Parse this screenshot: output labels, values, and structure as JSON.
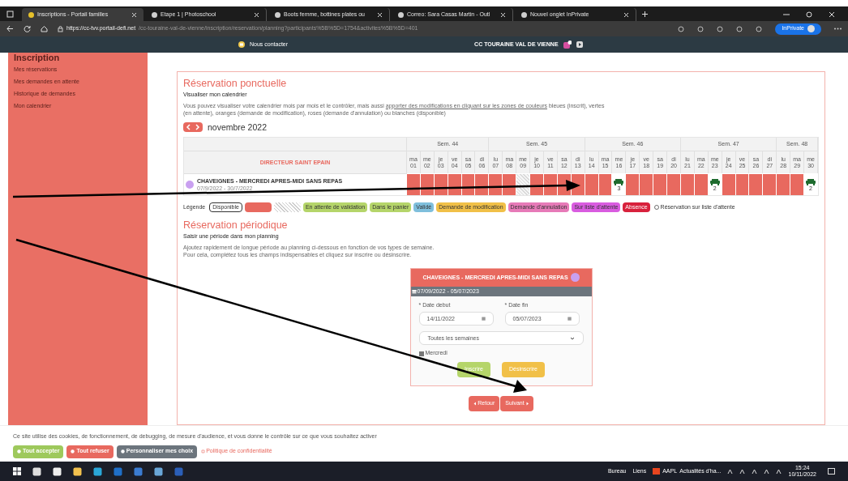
{
  "browser": {
    "tabs": [
      {
        "title": "Inscriptions - Portail familles",
        "selected": true
      },
      {
        "title": "Etape 1 | Photoschool",
        "selected": false
      },
      {
        "title": "Boots femme, bottines plates ou",
        "selected": false
      },
      {
        "title": "Correo: Sara Casas Martin - Outl",
        "selected": false
      },
      {
        "title": "Nouvel onglet InPrivate",
        "selected": false
      }
    ],
    "url_host": "https://cc-tvv.portail-defi.net",
    "url_path": "/cc-touraine-val-de-vienne/inscription/reservation/planning?participants%5B%5D=1754&activites%5B%5D=401",
    "profile": "InPrivate"
  },
  "header": {
    "contact": "Nous contacter",
    "organisation": "CC TOURAINE VAL DE VIENNE"
  },
  "sidebar": {
    "heading": "Inscription",
    "items": [
      "Mes réservations",
      "Mes demandes en attente",
      "Historique de demandes",
      "Mon calendrier"
    ]
  },
  "ponctuelle": {
    "title": "Réservation ponctuelle",
    "subtitle": "Visualiser mon calendrier",
    "description": "Vous pouvez visualiser votre calendrier mois par mois et le contrôler, mais aussi",
    "description_link": "apporter des modifications en cliquant sur les zones de couleurs",
    "description_end": "bleues (inscrit), vertes (en attente), oranges (demande de modification), roses (demande d'annulation) ou blanches (disponible)",
    "month": "novembre 2022",
    "group": "DIRECTEUR SAINT EPAIN",
    "weeks": [
      {
        "label": "Sem. 44",
        "days": [
          [
            "ma",
            "01"
          ],
          [
            "me",
            "02"
          ],
          [
            "je",
            "03"
          ],
          [
            "ve",
            "04"
          ],
          [
            "sa",
            "05"
          ],
          [
            "di",
            "06"
          ]
        ]
      },
      {
        "label": "Sem. 45",
        "days": [
          [
            "lu",
            "07"
          ],
          [
            "ma",
            "08"
          ],
          [
            "me",
            "09"
          ],
          [
            "je",
            "10"
          ],
          [
            "ve",
            "11"
          ],
          [
            "sa",
            "12"
          ],
          [
            "di",
            "13"
          ]
        ]
      },
      {
        "label": "Sem. 46",
        "days": [
          [
            "lu",
            "14"
          ],
          [
            "ma",
            "15"
          ],
          [
            "me",
            "16"
          ],
          [
            "je",
            "17"
          ],
          [
            "ve",
            "18"
          ],
          [
            "sa",
            "19"
          ],
          [
            "di",
            "20"
          ]
        ]
      },
      {
        "label": "Sem. 47",
        "days": [
          [
            "lu",
            "21"
          ],
          [
            "ma",
            "22"
          ],
          [
            "me",
            "23"
          ],
          [
            "je",
            "24"
          ],
          [
            "ve",
            "25"
          ],
          [
            "sa",
            "26"
          ],
          [
            "di",
            "27"
          ]
        ]
      },
      {
        "label": "Sem. 48",
        "days": [
          [
            "lu",
            "28"
          ],
          [
            "ma",
            "29"
          ],
          [
            "me",
            "30"
          ]
        ]
      }
    ],
    "activity": {
      "name": "CHAVEIGNES - MERCREDI APRES-MIDI SANS REPAS",
      "dates": "07/9/2022 - 30/7/2022",
      "color": "#c9a0f0",
      "cells": [
        {
          "kind": "reserved"
        },
        {
          "kind": "reserved"
        },
        {
          "kind": "reserved"
        },
        {
          "kind": "reserved"
        },
        {
          "kind": "reserved"
        },
        {
          "kind": "reserved"
        },
        {
          "kind": "reserved"
        },
        {
          "kind": "reserved"
        },
        {
          "kind": "closed"
        },
        {
          "kind": "reserved"
        },
        {
          "kind": "reserved"
        },
        {
          "kind": "reserved"
        },
        {
          "kind": "reserved"
        },
        {
          "kind": "reserved"
        },
        {
          "kind": "reserved"
        },
        {
          "kind": "waitlist",
          "count": "3"
        },
        {
          "kind": "reserved"
        },
        {
          "kind": "reserved"
        },
        {
          "kind": "reserved"
        },
        {
          "kind": "reserved"
        },
        {
          "kind": "reserved"
        },
        {
          "kind": "reserved"
        },
        {
          "kind": "waitlist",
          "count": "2"
        },
        {
          "kind": "reserved"
        },
        {
          "kind": "reserved"
        },
        {
          "kind": "reserved"
        },
        {
          "kind": "reserved"
        },
        {
          "kind": "reserved"
        },
        {
          "kind": "reserved"
        },
        {
          "kind": "waitlist",
          "count": "2"
        }
      ]
    },
    "legend_label": "Légende",
    "legend": [
      {
        "kind": "outlined",
        "label": "Disponible"
      },
      {
        "kind": "solid",
        "color": "#e8695f"
      },
      {
        "kind": "hatched"
      },
      {
        "kind": "solid",
        "label": "En attente de validation",
        "color": "#b5d56a"
      },
      {
        "kind": "solid",
        "label": "Dans le panier",
        "color": "#b5d56a"
      },
      {
        "kind": "solid",
        "label": "Validé",
        "color": "#7fbfdc"
      },
      {
        "kind": "solid",
        "label": "Demande de modification",
        "color": "#f1c048"
      },
      {
        "kind": "solid",
        "label": "Demande d'annulation",
        "color": "#e77ab8"
      },
      {
        "kind": "solid",
        "label": "Sur liste d'attente",
        "color": "#d95ce0"
      },
      {
        "kind": "solid",
        "label": "Absence",
        "color": "#d8213c"
      }
    ],
    "legend_note": "Réservation sur liste d'attente"
  },
  "periodique": {
    "title": "Réservation périodique",
    "subtitle": "Saisir une période dans mon planning",
    "description": [
      "Ajoutez rapidement de longue période au planning ci-dessous en fonction de vos types de semaine.",
      "Pour cela, complétez tous les champs indispensables et cliquez sur inscrire ou désinscrire."
    ],
    "card": {
      "title": "CHAVEIGNES - MERCREDI APRES-MIDI SANS REPAS",
      "color": "#c9a0f0",
      "period": "07/09/2022 - 05/07/2023",
      "start_label": "* Date debut",
      "start_value": "14/11/2022",
      "end_label": "* Date fin",
      "end_value": "05/07/2023",
      "frequency": "Toutes les semaines",
      "days": [
        {
          "label": "Mercredi",
          "checked": true
        }
      ],
      "subscribe": "Inscrire",
      "unsubscribe": "Désinscrire"
    },
    "back": "Retour",
    "next": "Suivant"
  },
  "cookies": {
    "text": "Ce site utilise des cookies, de fonctionnement, de debugging, de mesure d'audience, et vous donne le contrôle sur ce que vous souhaitez activer",
    "buttons": [
      {
        "kind": "accept",
        "label": "Tout accepter"
      },
      {
        "kind": "refuse",
        "label": "Tout refuser"
      },
      {
        "kind": "custom",
        "label": "Personnaliser mes choix"
      }
    ],
    "policy": "Politique de confidentialité"
  },
  "taskbar": {
    "desktop": "Bureau",
    "links": "Liens",
    "news": "AAPL  Actualités d'ha...",
    "time": "15:24",
    "date": "10/11/2022"
  }
}
